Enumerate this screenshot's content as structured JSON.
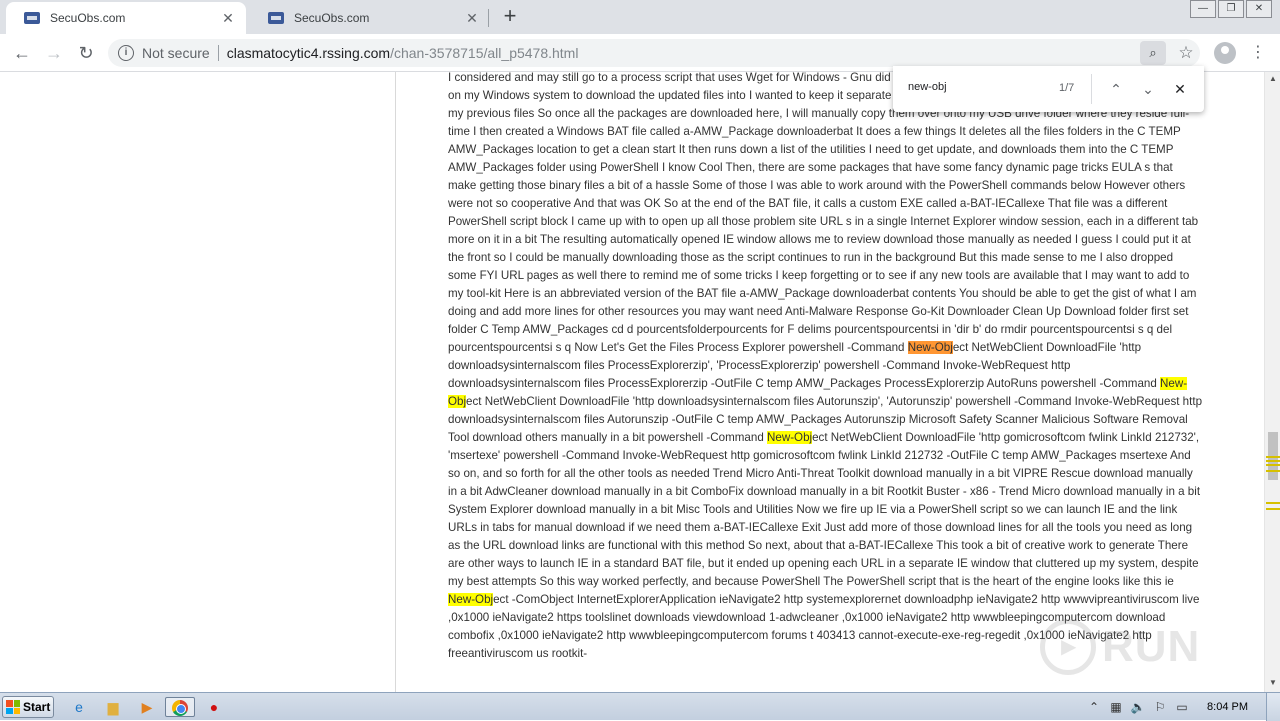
{
  "browser": {
    "tabs": [
      {
        "title": "SecuObs.com",
        "active": true
      },
      {
        "title": "SecuObs.com",
        "active": false
      }
    ],
    "new_tab_label": "+",
    "window_controls": {
      "minimize": "—",
      "restore": "❐",
      "close": "✕"
    },
    "nav": {
      "back": "←",
      "forward": "→",
      "reload": "↻"
    },
    "address": {
      "security_label": "Not secure",
      "host": "clasmatocytic4.rssing.com",
      "path": "/chan-3578715/all_p5478.html"
    },
    "find_icon": "⌕",
    "bookmark_icon": "☆",
    "menu_icon": "⋮"
  },
  "find_bar": {
    "query": "new-obj",
    "count": "1/7",
    "prev_icon": "⌃",
    "next_icon": "⌄",
    "close_icon": "✕"
  },
  "article": {
    "segments": [
      {
        "t": "I considered and may still go to a process script that uses Wget for Windows - Gnu did for now To get the ball rolling, I made a landing zone folder on my Windows system to download the updated files into I wanted to keep it separate in case I decided I didn t want to end up overwriting any of my previous files So once all the packages are downloaded here, I will manually copy them over onto my USB drive folder where they reside full-time I then created a Windows BAT file called a-AMW_Package downloaderbat It does a few things It deletes all the files folders in the C TEMP AMW_Packages location to get a clean start It then runs down a list of the utilities I need to get update, and downloads them into the C TEMP AMW_Packages folder using PowerShell I know Cool Then, there are some packages that have some fancy dynamic page tricks EULA s that make getting those binary files a bit of a hassle Some of those I was able to work around with the PowerShell commands below However others were not so cooperative And that was OK So at the end of the BAT file, it calls a custom EXE called a-BAT-IECallexe That file was a different PowerShell script block I came up with to open up all those problem site URL s in a single Internet Explorer window session, each in a different tab more on it in a bit The resulting automatically opened IE window allows me to review download those manually as needed I guess I could put it at the front so I could be manually downloading those as the script continues to run in the background But this made sense to me I also dropped some FYI URL pages as well there to remind me of some tricks I keep forgetting or to see if any new tools are available that I may want to add to my tool-kit Here is an abbreviated version of the BAT file a-AMW_Package downloaderbat contents You should be able to get the gist of what I am doing and add more lines for other resources you may want need Anti-Malware Response Go-Kit Downloader Clean Up Download folder first set folder C Temp AMW_Packages cd d pourcentsfolderpourcents for F delims pourcentspourcentsi in 'dir b' do rmdir pourcentspourcentsi s q del pourcentspourcentsi s q Now Let's Get the Files Process Explorer powershell -Command ",
        "h": 0
      },
      {
        "t": "New-Obj",
        "h": 2
      },
      {
        "t": "ect NetWebClient DownloadFile 'http downloadsysinternalscom files ProcessExplorerzip', 'ProcessExplorerzip' powershell -Command Invoke-WebRequest http downloadsysinternalscom files ProcessExplorerzip -OutFile C temp AMW_Packages ProcessExplorerzip AutoRuns powershell -Command ",
        "h": 0
      },
      {
        "t": "New-Obj",
        "h": 1
      },
      {
        "t": "ect NetWebClient DownloadFile 'http downloadsysinternalscom files Autorunszip', 'Autorunszip' powershell -Command Invoke-WebRequest http downloadsysinternalscom files Autorunszip -OutFile C temp AMW_Packages Autorunszip Microsoft Safety Scanner Malicious Software Removal Tool download others manually in a bit powershell -Command ",
        "h": 0
      },
      {
        "t": "New-Obj",
        "h": 1
      },
      {
        "t": "ect NetWebClient DownloadFile 'http gomicrosoftcom fwlink LinkId 212732', 'msertexe' powershell -Command Invoke-WebRequest http gomicrosoftcom fwlink LinkId 212732 -OutFile C temp AMW_Packages msertexe And so on, and so forth for all the other tools as needed Trend Micro Anti-Threat Toolkit download manually in a bit VIPRE Rescue download manually in a bit AdwCleaner download manually in a bit ComboFix download manually in a bit Rootkit Buster - x86 - Trend Micro download manually in a bit System Explorer download manually in a bit Misc Tools and Utilities Now we fire up IE via a PowerShell script so we can launch IE and the link URLs in tabs for manual download if we need them a-BAT-IECallexe Exit Just add more of those download lines for all the tools you need as long as the URL download links are functional with this method So next, about that a-BAT-IECallexe This took a bit of creative work to generate There are other ways to launch IE in a standard BAT file, but it ended up opening each URL in a separate IE window that cluttered up my system, despite my best attempts So this way worked perfectly, and because PowerShell The PowerShell script that is the heart of the engine looks like this ie ",
        "h": 0
      },
      {
        "t": "New-Obj",
        "h": 1
      },
      {
        "t": "ect -ComObject InternetExplorerApplication ieNavigate2 http systemexplorernet downloadphp ieNavigate2 http wwwvipreantiviruscom live ,0x1000 ieNavigate2 https toolslinet downloads viewdownload 1-adwcleaner ,0x1000 ieNavigate2 http wwwbleepingcomputercom download combofix ,0x1000 ieNavigate2 http wwwbleepingcomputercom forums t 403413 cannot-execute-exe-reg-regedit ,0x1000 ieNavigate2 http freeantiviruscom us rootkit-",
        "h": 0
      }
    ]
  },
  "watermark": {
    "text": "RUN"
  },
  "taskbar": {
    "start_label": "Start",
    "clock": "8:04 PM",
    "icons": [
      {
        "name": "ie-icon",
        "glyph": "e",
        "color": "#1e78c8"
      },
      {
        "name": "explorer-icon",
        "glyph": "▆",
        "color": "#e0b040"
      },
      {
        "name": "media-player-icon",
        "glyph": "▶",
        "color": "#e08020"
      },
      {
        "name": "chrome-icon",
        "glyph": "",
        "color": ""
      },
      {
        "name": "stop-icon",
        "glyph": "●",
        "color": "#d01010"
      }
    ],
    "tray": [
      {
        "name": "tray-expand-icon",
        "glyph": "⌃"
      },
      {
        "name": "tray-network-icon",
        "glyph": "▦"
      },
      {
        "name": "tray-volume-icon",
        "glyph": "🔈"
      },
      {
        "name": "tray-flag-icon",
        "glyph": "⚐"
      },
      {
        "name": "tray-monitor-icon",
        "glyph": "▭"
      }
    ]
  },
  "colors": {
    "match_highlight": "#ffff00",
    "current_match": "#ff9632",
    "tabstrip": "#dee1e6"
  }
}
